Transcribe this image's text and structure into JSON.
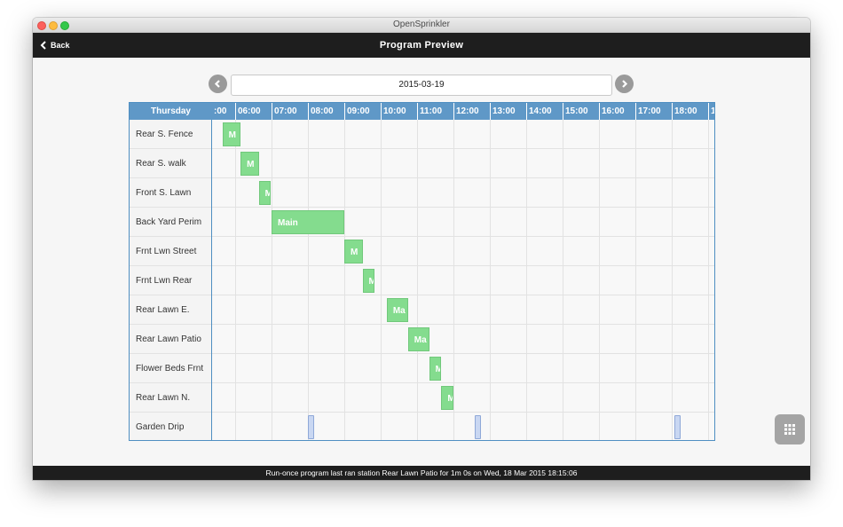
{
  "window": {
    "title": "OpenSprinkler"
  },
  "header": {
    "back_label": "Back",
    "title": "Program Preview"
  },
  "date_nav": {
    "date": "2015-03-19"
  },
  "timeline": {
    "day_label": "Thursday",
    "ticks": [
      ":00",
      "06:00",
      "07:00",
      "08:00",
      "09:00",
      "10:00",
      "11:00",
      "12:00",
      "13:00",
      "14:00",
      "15:00",
      "16:00",
      "17:00",
      "18:00",
      "1"
    ],
    "stations": [
      "Rear S. Fence",
      "Rear S. walk",
      "Front S. Lawn",
      "Back Yard Perim",
      "Frnt Lwn Street",
      "Frnt Lwn Rear",
      "Rear Lawn E.",
      "Rear Lawn Patio",
      "Flower Beds Frnt",
      "Rear Lawn N.",
      "Garden Drip"
    ],
    "runs": [
      {
        "station": 0,
        "start": "05:39",
        "end": "06:09",
        "label": "M",
        "color": "#84dc8e"
      },
      {
        "station": 1,
        "start": "06:09",
        "end": "06:39",
        "label": "M",
        "color": "#84dc8e"
      },
      {
        "station": 2,
        "start": "06:39",
        "end": "06:59",
        "label": "M",
        "color": "#84dc8e"
      },
      {
        "station": 3,
        "start": "07:00",
        "end": "09:00",
        "label": "Main",
        "color": "#84dc8e"
      },
      {
        "station": 4,
        "start": "09:00",
        "end": "09:30",
        "label": "M",
        "color": "#84dc8e"
      },
      {
        "station": 5,
        "start": "09:30",
        "end": "09:50",
        "label": "M",
        "color": "#84dc8e"
      },
      {
        "station": 6,
        "start": "10:10",
        "end": "10:45",
        "label": "Ma",
        "color": "#84dc8e"
      },
      {
        "station": 7,
        "start": "10:45",
        "end": "11:20",
        "label": "Ma",
        "color": "#84dc8e"
      },
      {
        "station": 8,
        "start": "11:20",
        "end": "11:40",
        "label": "M",
        "color": "#84dc8e"
      },
      {
        "station": 9,
        "start": "11:40",
        "end": "12:00",
        "label": "M",
        "color": "#84dc8e"
      },
      {
        "station": 10,
        "start": "08:00",
        "end": "08:10",
        "label": "",
        "color": "#c9d7f2"
      },
      {
        "station": 10,
        "start": "12:35",
        "end": "12:45",
        "label": "",
        "color": "#c9d7f2"
      },
      {
        "station": 10,
        "start": "18:05",
        "end": "18:15",
        "label": "",
        "color": "#c9d7f2"
      }
    ]
  },
  "status_bar": {
    "text": "Run-once program last ran station Rear Lawn Patio for 1m 0s on Wed, 18 Mar 2015 18:15:06"
  }
}
